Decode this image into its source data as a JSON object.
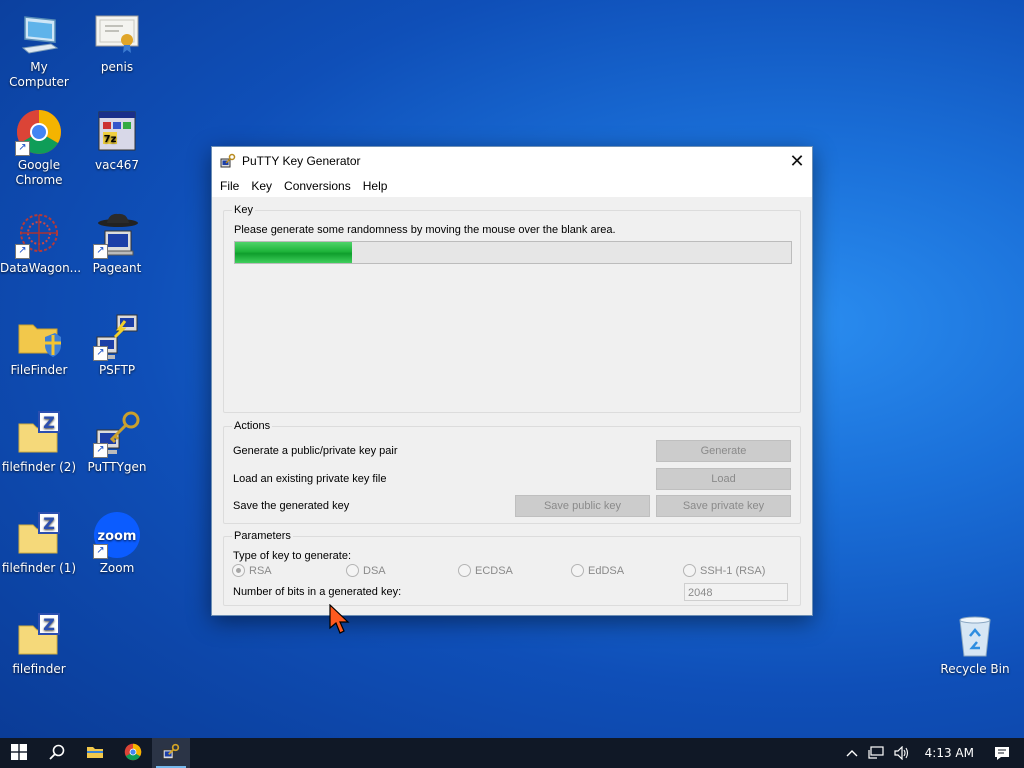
{
  "desktop": {
    "icons": [
      {
        "label": "My Computer"
      },
      {
        "label": "penis"
      },
      {
        "label": "Google Chrome"
      },
      {
        "label": "vac467"
      },
      {
        "label": "DataWagon..."
      },
      {
        "label": "Pageant"
      },
      {
        "label": "FileFinder"
      },
      {
        "label": "PSFTP"
      },
      {
        "label": "filefinder (2)"
      },
      {
        "label": "PuTTYgen"
      },
      {
        "label": "filefinder (1)"
      },
      {
        "label": "Zoom"
      },
      {
        "label": "filefinder"
      },
      {
        "label": "Recycle Bin"
      }
    ],
    "zoom_text": "zoom"
  },
  "window": {
    "title": "PuTTY Key Generator",
    "close_glyph": "✕",
    "menu": [
      "File",
      "Key",
      "Conversions",
      "Help"
    ],
    "key_group": {
      "title": "Key",
      "instruction": "Please generate some randomness by moving the mouse over the blank area.",
      "progress_fraction": 0.21
    },
    "actions_group": {
      "title": "Actions",
      "generate_label": "Generate a public/private key pair",
      "generate_button": "Generate",
      "load_label": "Load an existing private key file",
      "load_button": "Load",
      "save_label": "Save the generated key",
      "save_public_button": "Save public key",
      "save_private_button": "Save private key"
    },
    "params_group": {
      "title": "Parameters",
      "type_label": "Type of key to generate:",
      "key_types": [
        "RSA",
        "DSA",
        "ECDSA",
        "EdDSA",
        "SSH-1 (RSA)"
      ],
      "selected_type": "RSA",
      "bits_label": "Number of bits in a generated key:",
      "bits_value": "2048"
    }
  },
  "taskbar": {
    "time": "4:13 AM"
  },
  "colors": {
    "accent": "#1a6fd8",
    "progress": "#1eb43a",
    "taskbar": "#101826"
  }
}
